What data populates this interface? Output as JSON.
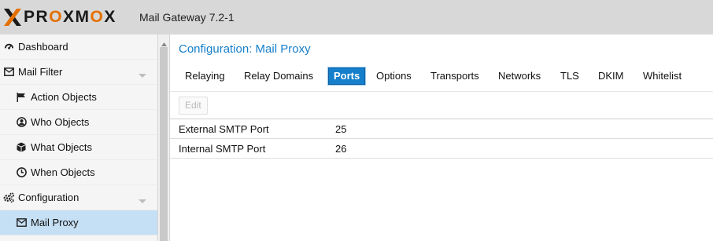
{
  "header": {
    "brand_prefix": "PR",
    "brand_o1": "O",
    "brand_mid": "XM",
    "brand_o2": "O",
    "brand_suffix": "X",
    "product": "Mail Gateway 7.2-1",
    "brand_orange": "#e57000"
  },
  "sidebar": {
    "items": [
      {
        "label": "Dashboard",
        "icon": "dashboard-icon"
      },
      {
        "label": "Mail Filter",
        "icon": "envelope-icon"
      },
      {
        "label": "Action Objects",
        "icon": "flag-icon"
      },
      {
        "label": "Who Objects",
        "icon": "user-icon"
      },
      {
        "label": "What Objects",
        "icon": "cube-icon"
      },
      {
        "label": "When Objects",
        "icon": "clock-icon"
      },
      {
        "label": "Configuration",
        "icon": "gears-icon"
      },
      {
        "label": "Mail Proxy",
        "icon": "envelope-icon"
      }
    ],
    "selected": "Mail Proxy",
    "selected_color": "#c5dff4"
  },
  "main": {
    "title": "Configuration: Mail Proxy",
    "title_color": "#157fcc",
    "tabs": [
      {
        "label": "Relaying"
      },
      {
        "label": "Relay Domains"
      },
      {
        "label": "Ports"
      },
      {
        "label": "Options"
      },
      {
        "label": "Transports"
      },
      {
        "label": "Networks"
      },
      {
        "label": "TLS"
      },
      {
        "label": "DKIM"
      },
      {
        "label": "Whitelist"
      }
    ],
    "active_tab": "Ports",
    "toolbar": {
      "edit_label": "Edit"
    },
    "rows": [
      {
        "name": "External SMTP Port",
        "value": "25"
      },
      {
        "name": "Internal SMTP Port",
        "value": "26"
      }
    ]
  }
}
